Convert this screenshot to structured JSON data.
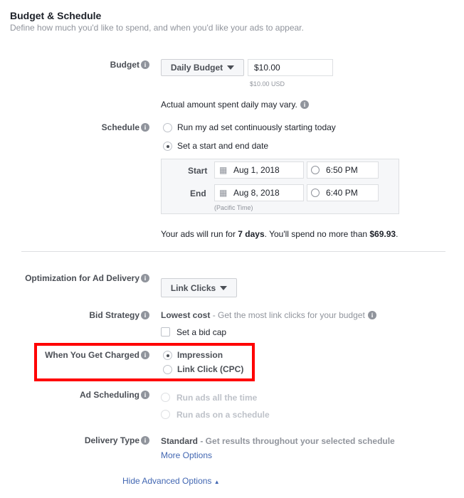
{
  "section": {
    "title": "Budget & Schedule",
    "subtitle": "Define how much you'd like to spend, and when you'd like your ads to appear."
  },
  "budget": {
    "label": "Budget",
    "type": "Daily Budget",
    "amount": "$10.00",
    "amount_hint": "$10.00 USD",
    "note": "Actual amount spent daily may vary."
  },
  "schedule": {
    "label": "Schedule",
    "option_continuous": "Run my ad set continuously starting today",
    "option_dates": "Set a start and end date",
    "selected": "Set a start and end date",
    "start_label": "Start",
    "start_date": "Aug 1, 2018",
    "start_time": "6:50 PM",
    "end_label": "End",
    "end_date": "Aug 8, 2018",
    "end_time": "6:40 PM",
    "timezone": "(Pacific Time)",
    "summary_pre": "Your ads will run for ",
    "summary_days": "7 days",
    "summary_mid": ". You'll spend no more than ",
    "summary_amount": "$69.93",
    "summary_end": "."
  },
  "optimization": {
    "label": "Optimization for Ad Delivery",
    "value": "Link Clicks"
  },
  "bid": {
    "label": "Bid Strategy",
    "value": "Lowest cost",
    "desc": " - Get the most link clicks for your budget",
    "bid_cap": "Set a bid cap"
  },
  "charged": {
    "label": "When You Get Charged",
    "option1": "Impression",
    "option2": "Link Click (CPC)",
    "selected": "Impression",
    "highlight_color": "#ff0000"
  },
  "ad_scheduling": {
    "label": "Ad Scheduling",
    "option1": "Run ads all the time",
    "option2": "Run ads on a schedule"
  },
  "delivery": {
    "label": "Delivery Type",
    "value": "Standard",
    "desc": " - Get results throughout your selected schedule",
    "more": "More Options"
  },
  "hide_advanced": "Hide Advanced Options"
}
